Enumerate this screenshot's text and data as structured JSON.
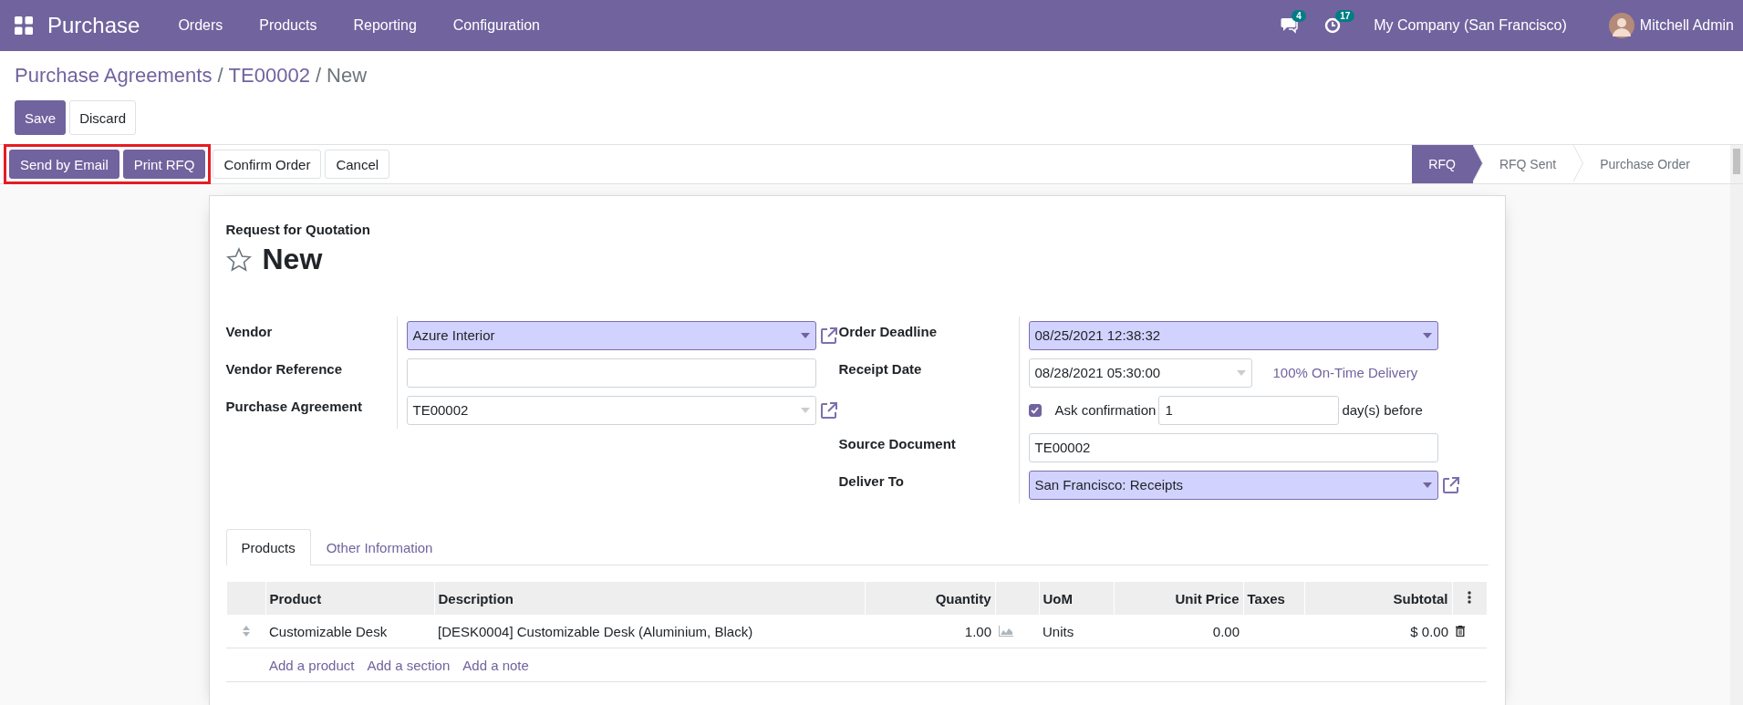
{
  "navbar": {
    "app": "Purchase",
    "menu": [
      "Orders",
      "Products",
      "Reporting",
      "Configuration"
    ],
    "messages_badge": "4",
    "activities_badge": "17",
    "company": "My Company (San Francisco)",
    "user": "Mitchell Admin"
  },
  "breadcrumb": {
    "separator": "/",
    "items": [
      {
        "label": "Purchase Agreements",
        "kind": "link"
      },
      {
        "label": "TE00002",
        "kind": "link"
      },
      {
        "label": "New",
        "kind": "current"
      }
    ]
  },
  "edit_buttons": [
    {
      "label": "Save",
      "primary": true
    },
    {
      "label": "Discard",
      "primary": false
    }
  ],
  "highlight_frame": {
    "buttons": [
      {
        "label": "Send by Email",
        "primary": true
      },
      {
        "label": "Print RFQ",
        "primary": true
      }
    ]
  },
  "action_buttons": [
    {
      "label": "Confirm Order",
      "primary": false
    },
    {
      "label": "Cancel",
      "primary": false
    }
  ],
  "status_steps": [
    {
      "label": "RFQ",
      "selected": true
    },
    {
      "label": "RFQ Sent",
      "selected": false
    },
    {
      "label": "Purchase Order",
      "selected": false
    }
  ],
  "form": {
    "subtitle": "Request for Quotation",
    "title": "New",
    "starred": false,
    "left_fields": [
      {
        "label": "Vendor",
        "kind": "many2one",
        "value": "Azure Interior",
        "required": true,
        "external_link": true
      },
      {
        "label": "Vendor Reference",
        "kind": "text",
        "required": false
      },
      {
        "label": "Purchase Agreement",
        "kind": "many2one",
        "value": "TE00002",
        "required": false,
        "external_link": true
      }
    ],
    "right_fields": [
      {
        "label": "Order Deadline",
        "kind": "datetime",
        "value": "08/25/2021 12:38:32",
        "required": true
      },
      {
        "label": "Receipt Date",
        "kind": "datetime",
        "value": "08/28/2021 05:30:00",
        "required": false,
        "note": "100% On-Time Delivery"
      },
      {
        "kind": "confirmation",
        "checked": true,
        "label": "Ask confirmation",
        "value": "1",
        "suffix": "day(s) before"
      },
      {
        "label": "Source Document",
        "kind": "text",
        "value": "TE00002",
        "required": false
      },
      {
        "label": "Deliver To",
        "kind": "many2one",
        "value": "San Francisco: Receipts",
        "required": true,
        "external_link": true
      }
    ]
  },
  "tabs": [
    {
      "label": "Products",
      "selected": true
    },
    {
      "label": "Other Information",
      "selected": false
    }
  ],
  "table": {
    "columns": [
      {
        "kind": "handle"
      },
      {
        "kind": "text",
        "label": "Product"
      },
      {
        "kind": "text",
        "label": "Description"
      },
      {
        "kind": "number",
        "label": "Quantity"
      },
      {
        "kind": "forecast"
      },
      {
        "kind": "text",
        "label": "UoM"
      },
      {
        "kind": "number",
        "label": "Unit Price"
      },
      {
        "kind": "text",
        "label": "Taxes"
      },
      {
        "kind": "number",
        "label": "Subtotal"
      },
      {
        "kind": "menu"
      }
    ],
    "rows": [
      {
        "cells": [
          "",
          "Customizable Desk",
          "[DESK0004] Customizable Desk (Aluminium, Black)",
          "1.00",
          "",
          "Units",
          "0.00",
          "",
          "$ 0.00",
          ""
        ]
      }
    ],
    "add_links": [
      "Add a product",
      "Add a section",
      "Add a note"
    ]
  }
}
